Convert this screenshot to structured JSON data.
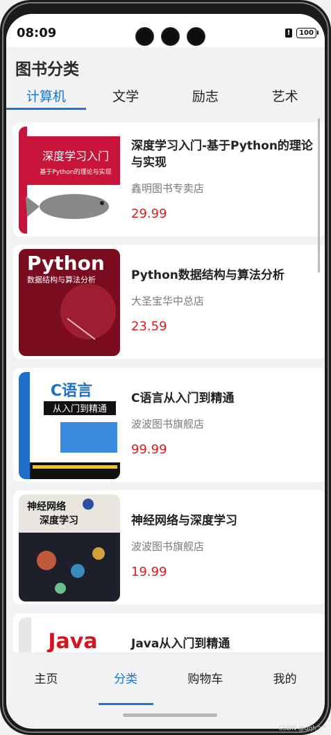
{
  "status": {
    "time": "08:09",
    "battery": "100"
  },
  "header": {
    "title": "图书分类"
  },
  "tabs": [
    {
      "label": "计算机",
      "active": true
    },
    {
      "label": "文学",
      "active": false
    },
    {
      "label": "励志",
      "active": false
    },
    {
      "label": "艺术",
      "active": false
    }
  ],
  "books": [
    {
      "title": "深度学习入门-基于Python的理论与实现",
      "store": "鑫明图书专卖店",
      "price": "29.99",
      "cover_color": "#c8143a",
      "cover_title": "深度学习入门",
      "cover_subtitle": "基于Python的理论与实现"
    },
    {
      "title": "Python数据结构与算法分析",
      "store": "大圣宝华中总店",
      "price": "23.59",
      "cover_color": "#7a0c20",
      "cover_title": "Python",
      "cover_subtitle": "数据结构与算法分析"
    },
    {
      "title": "C语言从入门到精通",
      "store": "波波图书旗舰店",
      "price": "99.99",
      "cover_color": "#1e6fc9",
      "cover_title": "C语言",
      "cover_subtitle": "从入门到精通"
    },
    {
      "title": "神经网络与深度学习",
      "store": "波波图书旗舰店",
      "price": "19.99",
      "cover_color": "#1d1f2a",
      "cover_title": "神经网络",
      "cover_subtitle": "深度学习"
    },
    {
      "title": "Java从入门到精通",
      "store": "",
      "price": "",
      "cover_color": "#d7131f",
      "cover_title": "Java",
      "cover_subtitle": ""
    }
  ],
  "nav": [
    {
      "label": "主页",
      "active": false
    },
    {
      "label": "分类",
      "active": true
    },
    {
      "label": "购物车",
      "active": false
    },
    {
      "label": "我的",
      "active": false
    }
  ],
  "watermark": "CSDN @gqh^^"
}
